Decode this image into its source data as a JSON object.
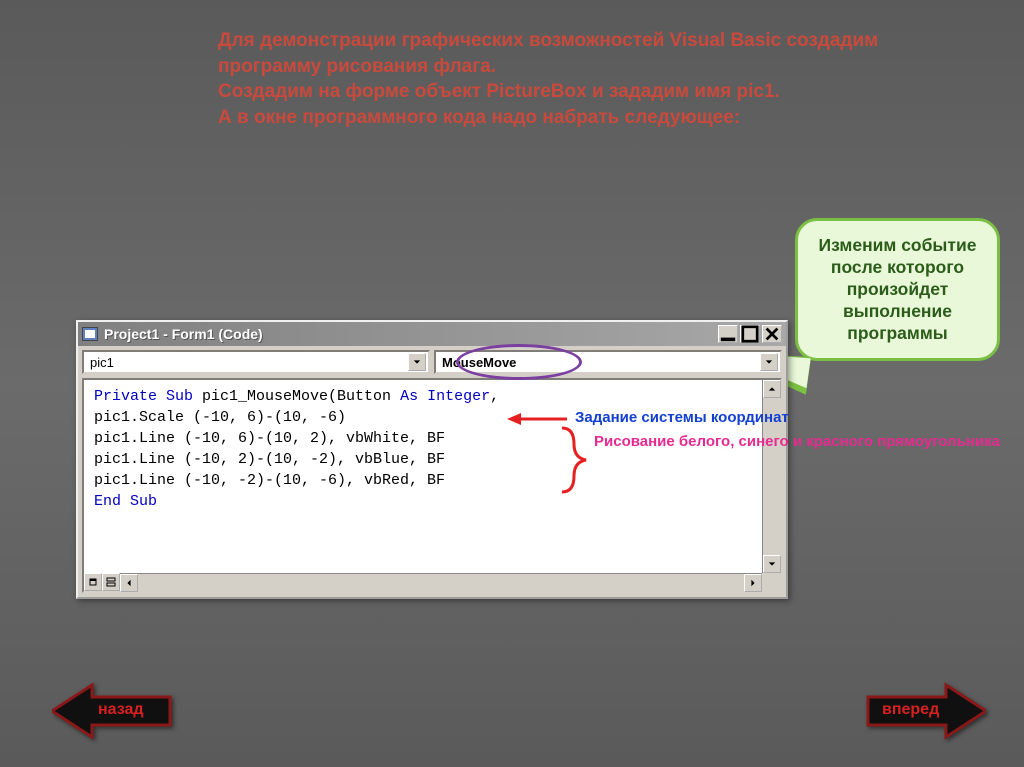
{
  "header": {
    "line1": "Для демонстрации графических возможностей Visual Basic создадим программу рисования флага.",
    "line2": "Создадим на форме объект PictureBox и зададим имя pic1.",
    "line3": "А в окне программного кода надо набрать следующее:"
  },
  "callout": {
    "text": "Изменим событие после которого произойдет выполнение программы"
  },
  "window": {
    "title": "Project1 - Form1 (Code)",
    "dropdown_left": "pic1",
    "dropdown_right": "MouseMove"
  },
  "code": {
    "l1a": "Private Sub",
    "l1b": " pic1_MouseMove(Button ",
    "l1c": "As Integer",
    "l1d": ",",
    "l2": "pic1.Scale (-10, 6)-(10, -6)",
    "l3": "pic1.Line (-10, 6)-(10, 2), vbWhite, BF",
    "l4": "pic1.Line (-10, 2)-(10, -2), vbBlue, BF",
    "l5": "pic1.Line (-10, -2)-(10, -6), vbRed, BF",
    "l6": "End Sub"
  },
  "annotations": {
    "coord": "Задание системы координат",
    "rects": "Рисование  белого, синего  и  красного прямоугольника"
  },
  "nav": {
    "back": "назад",
    "forward": "вперед"
  }
}
